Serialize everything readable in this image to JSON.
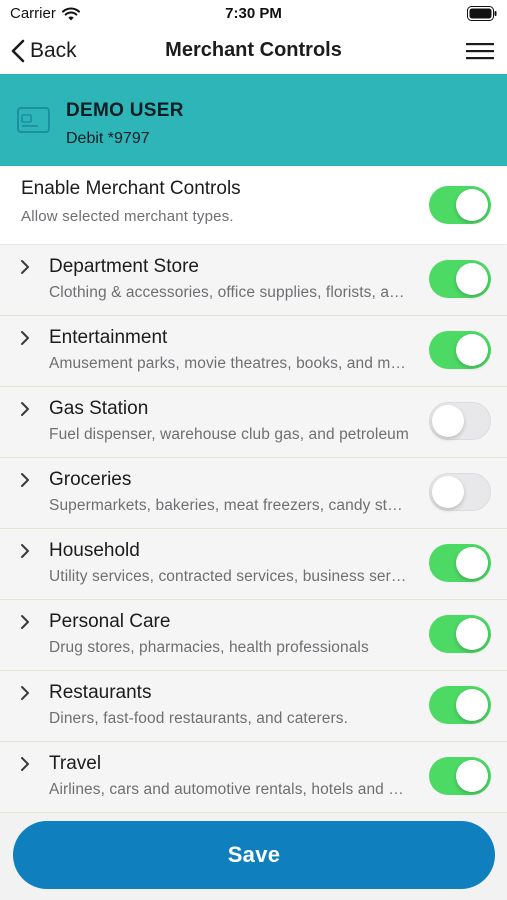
{
  "status_bar": {
    "carrier": "Carrier",
    "time": "7:30 PM"
  },
  "nav": {
    "back_label": "Back",
    "title": "Merchant Controls",
    "menu_icon": "hamburger-menu-icon"
  },
  "account": {
    "name": "DEMO USER",
    "card": "Debit *9797",
    "icon": "card-icon"
  },
  "enable": {
    "title": "Enable Merchant Controls",
    "subtitle": "Allow selected merchant types.",
    "enabled": true
  },
  "categories": [
    {
      "title": "Department Store",
      "description": "Clothing & accessories, office supplies, florists, and more",
      "enabled": true
    },
    {
      "title": "Entertainment",
      "description": "Amusement parks, movie theatres, books, and more",
      "enabled": true
    },
    {
      "title": "Gas Station",
      "description": "Fuel dispenser, warehouse club gas, and petroleum",
      "enabled": false
    },
    {
      "title": "Groceries",
      "description": "Supermarkets, bakeries, meat freezers, candy stores",
      "enabled": false
    },
    {
      "title": "Household",
      "description": "Utility services, contracted services, business services",
      "enabled": true
    },
    {
      "title": "Personal Care",
      "description": "Drug stores, pharmacies, health professionals",
      "enabled": true
    },
    {
      "title": "Restaurants",
      "description": "Diners, fast-food restaurants, and caterers.",
      "enabled": true
    },
    {
      "title": "Travel",
      "description": "Airlines, cars and automotive rentals, hotels and more",
      "enabled": true
    }
  ],
  "save_label": "Save",
  "colors": {
    "header": "#2db5b8",
    "toggle_on": "#4cd964",
    "save_button": "#0f7fbe"
  }
}
